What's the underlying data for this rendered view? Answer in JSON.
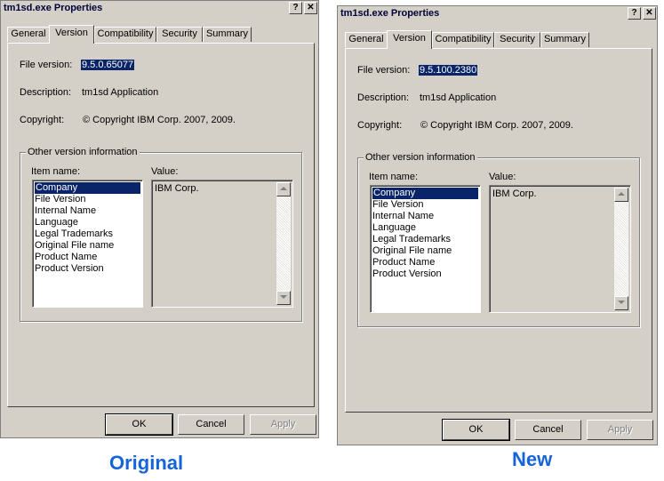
{
  "left": {
    "title": "tm1sd.exe Properties",
    "help_btn": "?",
    "close_btn": "✕",
    "tabs": [
      "General",
      "Version",
      "Compatibility",
      "Security",
      "Summary"
    ],
    "active_tab": "Version",
    "file_version_label": "File version:",
    "file_version_value": "9.5.0.65077",
    "description_label": "Description:",
    "description_value": "tm1sd Application",
    "copyright_label": "Copyright:",
    "copyright_value": "© Copyright IBM Corp. 2007, 2009.",
    "group_title": "Other version information",
    "item_name_label": "Item name:",
    "value_label": "Value:",
    "items": [
      "Company",
      "File Version",
      "Internal Name",
      "Language",
      "Legal Trademarks",
      "Original File name",
      "Product Name",
      "Product Version"
    ],
    "selected_item": "Company",
    "value_text": "IBM Corp.",
    "ok": "OK",
    "cancel": "Cancel",
    "apply": "Apply"
  },
  "right": {
    "title": "tm1sd.exe Properties",
    "help_btn": "?",
    "close_btn": "✕",
    "tabs": [
      "General",
      "Version",
      "Compatibility",
      "Security",
      "Summary"
    ],
    "active_tab": "Version",
    "file_version_label": "File version:",
    "file_version_value": "9.5.100.2380",
    "description_label": "Description:",
    "description_value": "tm1sd Application",
    "copyright_label": "Copyright:",
    "copyright_value": "© Copyright IBM Corp. 2007, 2009.",
    "group_title": "Other version information",
    "item_name_label": "Item name:",
    "value_label": "Value:",
    "items": [
      "Company",
      "File Version",
      "Internal Name",
      "Language",
      "Legal Trademarks",
      "Original File name",
      "Product Name",
      "Product Version"
    ],
    "selected_item": "Company",
    "value_text": "IBM Corp.",
    "ok": "OK",
    "cancel": "Cancel",
    "apply": "Apply"
  },
  "captions": {
    "left": "Original",
    "right": "New"
  },
  "colors": {
    "dialog_bg": "#d4d0c8",
    "selection": "#0a246a",
    "caption": "#1565d8"
  }
}
